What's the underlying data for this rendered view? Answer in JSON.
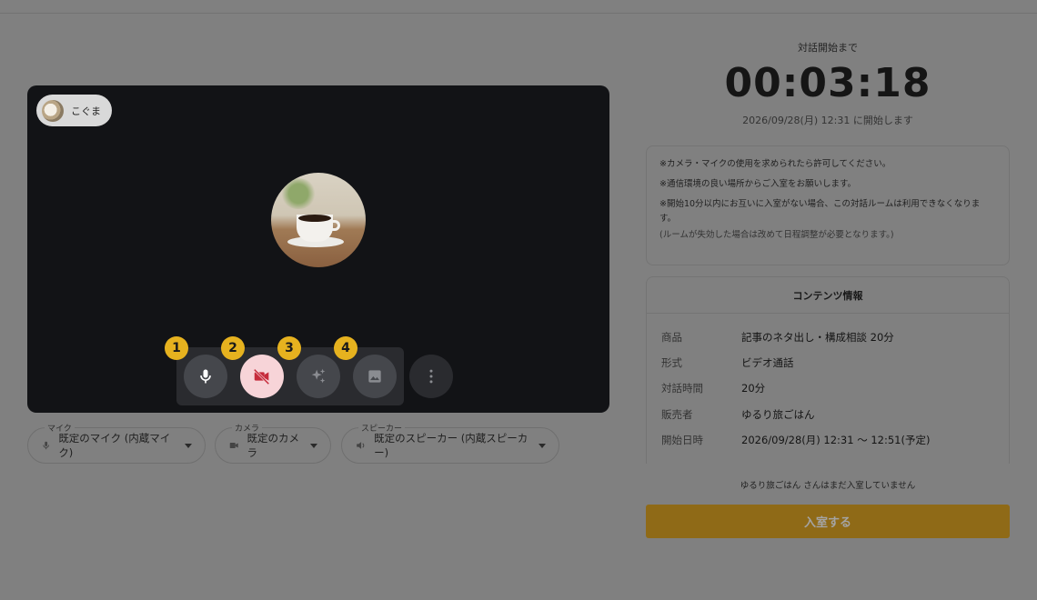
{
  "video": {
    "participant_name": "こぐま",
    "controls": [
      {
        "badge": "1",
        "icon": "microphone-icon"
      },
      {
        "badge": "2",
        "icon": "camera-off-icon"
      },
      {
        "badge": "3",
        "icon": "sparkle-effects-icon"
      },
      {
        "badge": "4",
        "icon": "background-image-icon"
      }
    ],
    "more_icon": "more-vertical-icon"
  },
  "devices": {
    "mic": {
      "label": "マイク",
      "value": "既定のマイク (内蔵マイク)"
    },
    "camera": {
      "label": "カメラ",
      "value": "既定のカメラ"
    },
    "speaker": {
      "label": "スピーカー",
      "value": "既定のスピーカー (内蔵スピーカー)"
    }
  },
  "countdown": {
    "label": "対話開始まで",
    "time": "00:03:18",
    "start_note": "2026/09/28(月) 12:31 に開始します"
  },
  "notices": [
    "※カメラ・マイクの使用を求められたら許可してください。",
    "※通信環境の良い場所からご入室をお願いします。",
    "※開始10分以内にお互いに入室がない場合、この対話ルームは利用できなくなります。"
  ],
  "notice_sub": "(ルームが失効した場合は改めて日程調整が必要となります。)",
  "content_info": {
    "title": "コンテンツ情報",
    "rows": [
      {
        "key": "商品",
        "value": "記事のネタ出し・構成相談 20分"
      },
      {
        "key": "形式",
        "value": "ビデオ通話"
      },
      {
        "key": "対話時間",
        "value": "20分"
      },
      {
        "key": "販売者",
        "value": "ゆるり旅ごはん"
      },
      {
        "key": "開始日時",
        "value": "2026/09/28(月) 12:31 〜 12:51(予定)"
      }
    ]
  },
  "status_message": "ゆるり旅ごはん さんはまだ入室していません",
  "enter_button": "入室する",
  "colors": {
    "background_overlay": "#808080",
    "video_bg": "#121316",
    "badge": "#e6b21f",
    "camera_off_bg": "#f7d4d8",
    "enter_button_bg": "#8f6a17"
  }
}
